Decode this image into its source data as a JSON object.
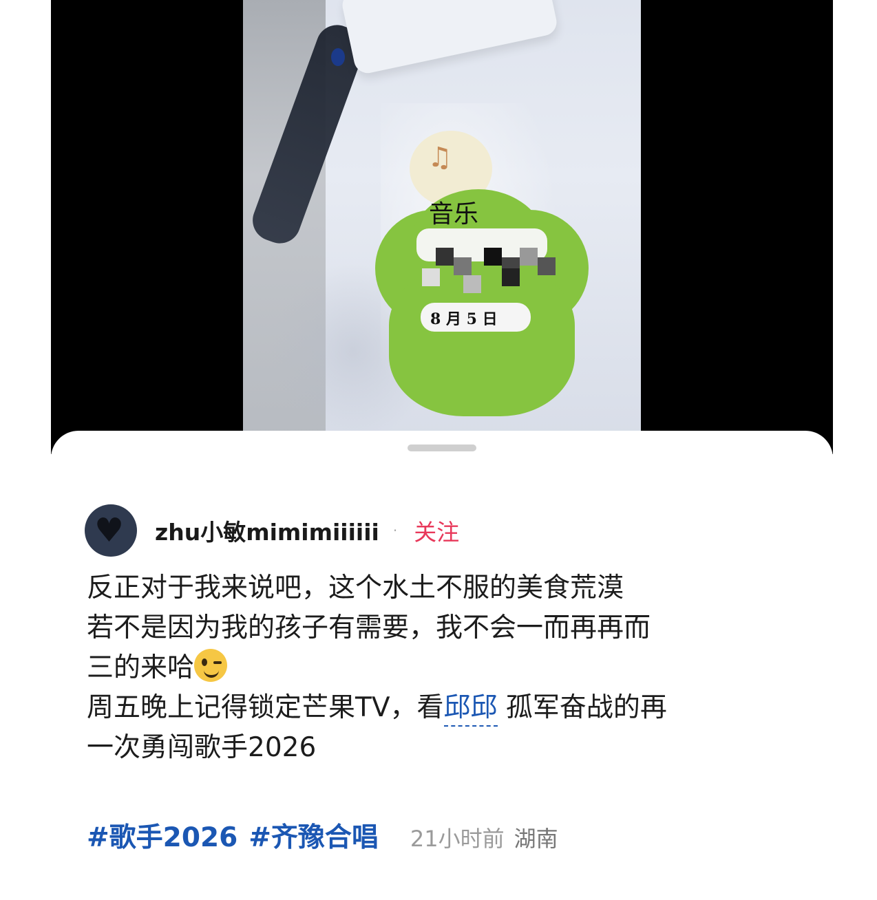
{
  "photo": {
    "sticker_handwriting_top": "音乐",
    "sticker_month_day": "8 月 5 日"
  },
  "post": {
    "author": {
      "username": "zhu小敏mimimiiiiii",
      "follow_label": "关注"
    },
    "text": {
      "line1": "反正对于我来说吧，这个水土不服的美食荒漠",
      "line2": "若不是因为我的孩子有需要，我不会一而再再而",
      "line3_prefix": "三的来哈",
      "line3_emoji": "wink-emoji",
      "line4_prefix": "周五晚上记得锁定芒果TV，看",
      "mention": "邱邱",
      "line4_suffix": " 孤军奋战的再",
      "line5": "一次勇闯歌手2026"
    },
    "hashtags": [
      "#歌手2026",
      "#齐豫合唱"
    ],
    "time": "21小时前",
    "location": "湖南"
  },
  "colors": {
    "mention": "#1b57b3",
    "follow": "#e8385a",
    "sticker_green": "#86c440"
  }
}
